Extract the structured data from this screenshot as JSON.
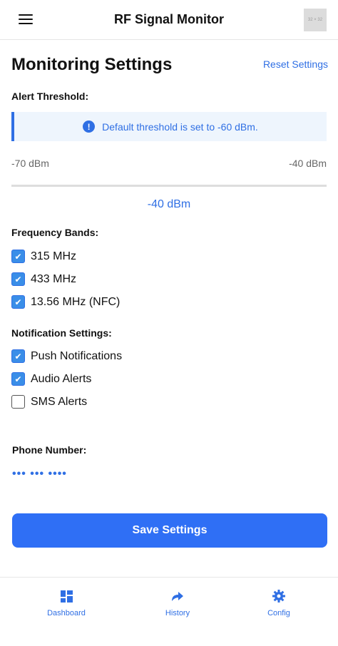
{
  "header": {
    "title": "RF Signal Monitor",
    "avatar_text": "32 × 32",
    "menu_icon": "hamburger-icon"
  },
  "page": {
    "title": "Monitoring Settings",
    "reset_label": "Reset Settings"
  },
  "threshold": {
    "label": "Alert Threshold:",
    "info_text": "Default threshold is set to -60 dBm.",
    "info_icon": "info-icon",
    "min_label": "-70 dBm",
    "max_label": "-40 dBm",
    "value_label": "-40 dBm",
    "value": -40,
    "min": -70,
    "max": -40
  },
  "bands": {
    "label": "Frequency Bands:",
    "items": [
      {
        "label": "315 MHz",
        "checked": true
      },
      {
        "label": "433 MHz",
        "checked": true
      },
      {
        "label": "13.56 MHz (NFC)",
        "checked": true
      }
    ]
  },
  "notifications": {
    "label": "Notification Settings:",
    "items": [
      {
        "label": "Push Notifications",
        "checked": true
      },
      {
        "label": "Audio Alerts",
        "checked": true
      },
      {
        "label": "SMS Alerts",
        "checked": false
      }
    ]
  },
  "phone": {
    "label": "Phone Number:",
    "masked_value": "••• ••• ••••"
  },
  "save_label": "Save Settings",
  "nav": {
    "items": [
      {
        "label": "Dashboard",
        "icon": "dashboard-icon"
      },
      {
        "label": "History",
        "icon": "history-icon"
      },
      {
        "label": "Config",
        "icon": "gear-icon"
      }
    ]
  },
  "colors": {
    "accent": "#2f6fe4",
    "button": "#2f6ff5",
    "info_bg": "#eef5fd"
  }
}
